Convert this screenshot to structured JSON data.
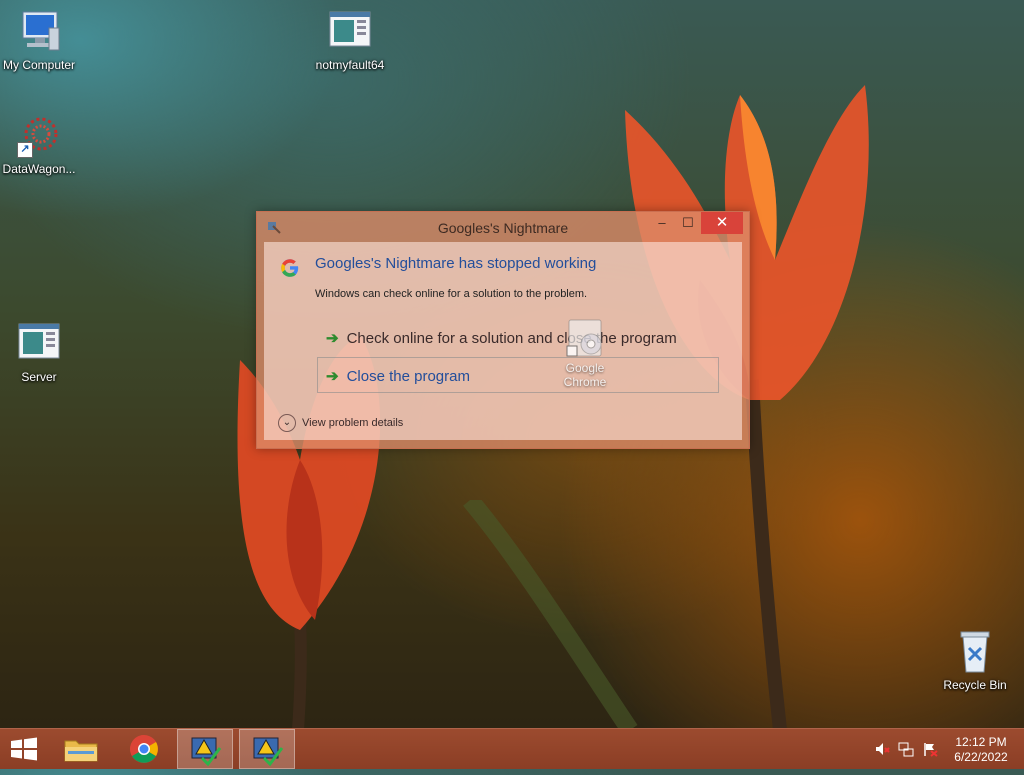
{
  "desktop": {
    "icons": [
      {
        "label": "My Computer"
      },
      {
        "label": "notmyfault64"
      },
      {
        "label": "DataWagon..."
      },
      {
        "label": "Server"
      },
      {
        "label": "Recycle Bin"
      }
    ],
    "chrome_shortcut": {
      "line1": "Google",
      "line2": "Chrome"
    }
  },
  "dialog": {
    "title": "Googles's Nightmare",
    "headline": "Googles's Nightmare has stopped working",
    "subtext": "Windows can check online for a solution to the problem.",
    "option_check_online": "Check online for a solution and close the program",
    "option_close": "Close the program",
    "details_label": "View problem details",
    "minimize_glyph": "–",
    "maximize_glyph": "☐",
    "close_glyph": "✕"
  },
  "taskbar": {
    "time": "12:12 PM",
    "date": "6/22/2022"
  },
  "colors": {
    "taskbar": "#8b3e25",
    "close_button": "#d9433a",
    "link_blue": "#234e9b",
    "arrow_green": "#2e8b2e"
  }
}
